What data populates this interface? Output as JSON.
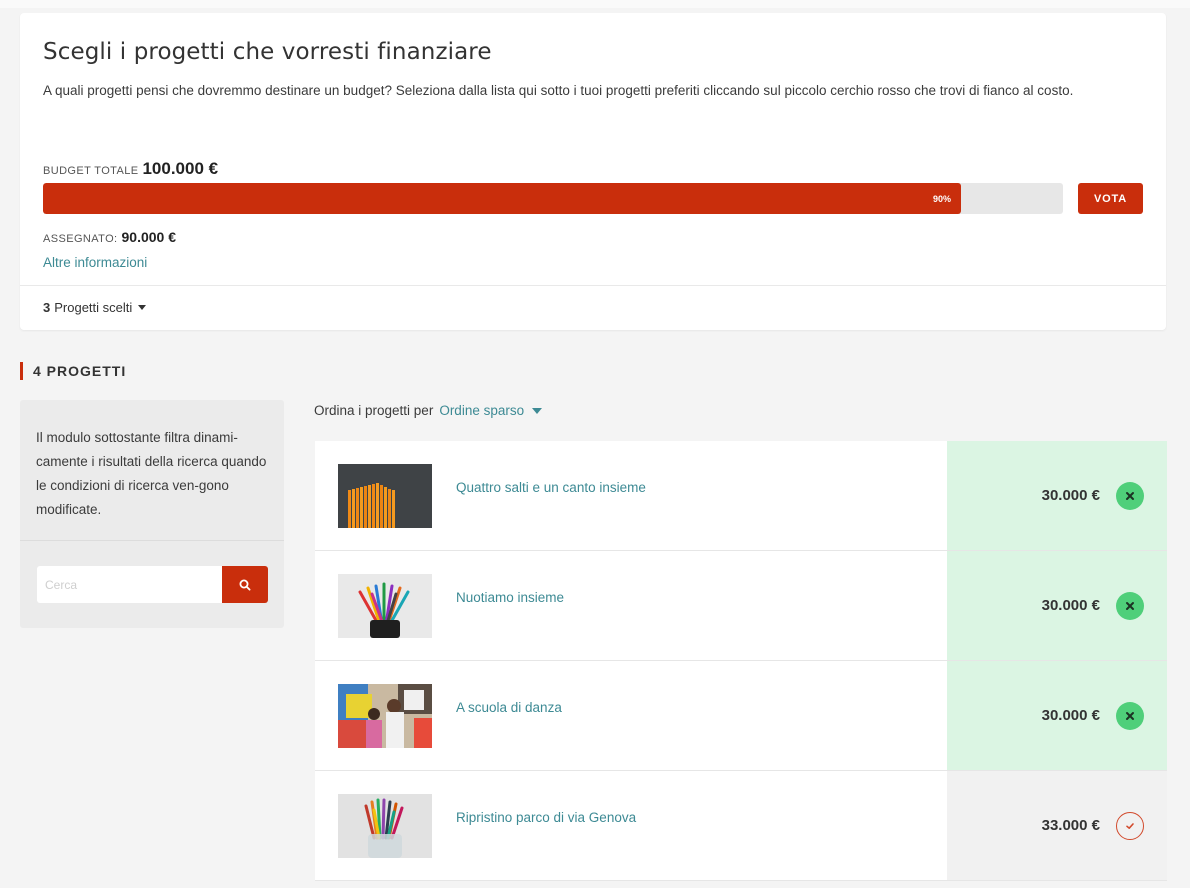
{
  "header": {
    "title": "Scegli i progetti che vorresti finanziare",
    "description": "A quali progetti pensi che dovremmo destinare un budget? Seleziona dalla lista qui sotto i tuoi progetti preferiti cliccando sul piccolo cerchio rosso che trovi di fianco al costo.",
    "budget_label": "BUDGET TOTALE",
    "budget_value": "100.000 €",
    "progress_percent": 90,
    "progress_label": "90%",
    "vote_label": "VOTA",
    "assigned_label": "ASSEGNATO:",
    "assigned_value": "90.000 €",
    "more_info": "Altre informazioni",
    "selected_count": "3",
    "selected_label": "Progetti scelti"
  },
  "section": {
    "title": "4 PROGETTI"
  },
  "filter": {
    "description": "Il modulo sottostante filtra dinami-camente i risultati della ricerca quando le condizioni di ricerca ven-gono modificate.",
    "search_placeholder": "Cerca",
    "search_icon": "search-icon"
  },
  "sort": {
    "label": "Ordina i progetti per",
    "value": "Ordine sparso"
  },
  "projects": [
    {
      "title": "Quattro salti e un canto insieme",
      "price": "30.000 €",
      "selected": true,
      "thumb": "pencils-row"
    },
    {
      "title": "Nuotiamo insieme",
      "price": "30.000 €",
      "selected": true,
      "thumb": "pencil-cup"
    },
    {
      "title": "A scuola di danza",
      "price": "30.000 €",
      "selected": true,
      "thumb": "mural-painting"
    },
    {
      "title": "Ripristino parco di via Genova",
      "price": "33.000 €",
      "selected": false,
      "thumb": "pencil-jar"
    }
  ],
  "colors": {
    "accent": "#c92e0c",
    "link": "#3d8a94",
    "selected_bg": "#dbf5e3",
    "selected_btn": "#4fcf7a"
  }
}
